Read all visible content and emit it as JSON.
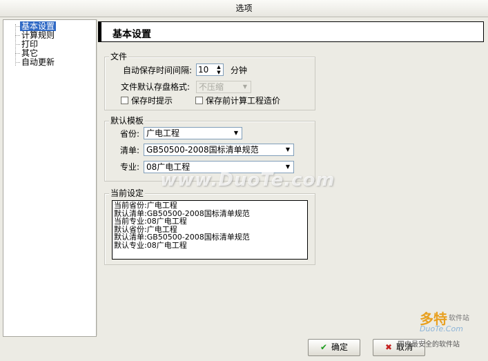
{
  "window": {
    "title": "选项"
  },
  "tree": {
    "items": [
      {
        "label": "基本设置",
        "selected": true
      },
      {
        "label": "计算规则",
        "selected": false
      },
      {
        "label": "打印",
        "selected": false
      },
      {
        "label": "其它",
        "selected": false
      },
      {
        "label": "自动更新",
        "selected": false
      }
    ]
  },
  "header": {
    "title": "基本设置"
  },
  "file_group": {
    "label": "文件",
    "autosave_label": "自动保存时间间隔:",
    "autosave_value": "10",
    "autosave_unit": "分钟",
    "format_label": "文件默认存盘格式:",
    "format_value": "不压缩",
    "prompt_on_save_label": "保存时提示",
    "prompt_on_save_checked": false,
    "calc_before_save_label": "保存前计算工程造价",
    "calc_before_save_checked": false
  },
  "template_group": {
    "label": "默认模板",
    "province_label": "省份:",
    "province_value": "广电工程",
    "list_label": "清单:",
    "list_value": "GB50500-2008国标清单规范",
    "specialty_label": "专业:",
    "specialty_value": "08广电工程"
  },
  "current_group": {
    "label": "当前设定",
    "lines": [
      "当前省份:广电工程",
      "默认清单:GB50500-2008国标清单规范",
      "当前专业:08广电工程",
      "默认省份:广电工程",
      "默认清单:GB50500-2008国标清单规范",
      "默认专业:08广电工程"
    ]
  },
  "buttons": {
    "ok_label": "确定",
    "cancel_label": "取消"
  },
  "watermark": {
    "text": "www.DuoTe.com"
  },
  "logo": {
    "name": "多特",
    "sub": "软件站",
    "url": "DuoTe.Com",
    "slogan": "国内最安全的软件站"
  },
  "colors": {
    "selection": "#316ac5",
    "ok_icon": "#1a9b1a",
    "cancel_icon": "#c41f1f"
  },
  "icons": {
    "ok": "checkmark-icon",
    "cancel": "x-icon",
    "dropdown": "chevron-down-icon",
    "spinner": "spin-arrows-icon"
  }
}
